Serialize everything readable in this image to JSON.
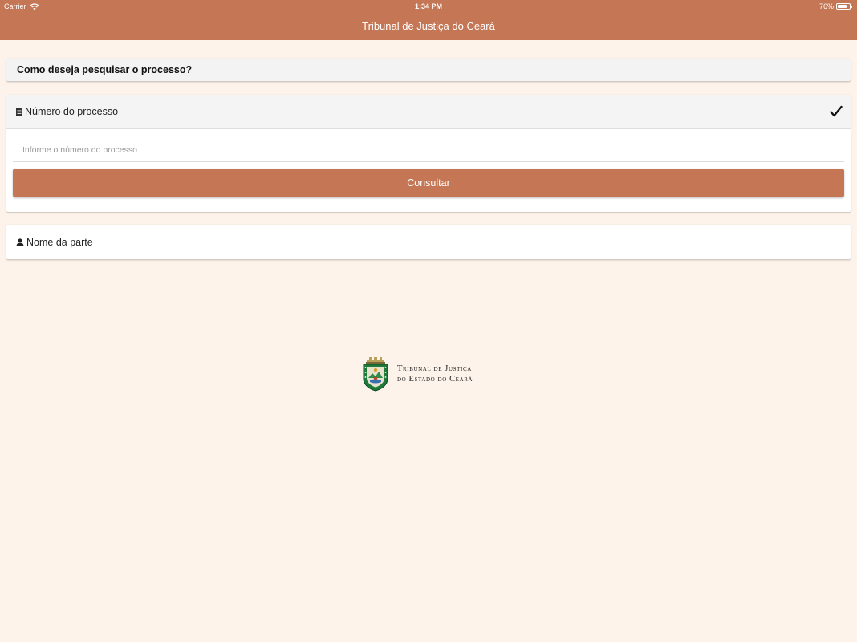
{
  "status_bar": {
    "carrier": "Carrier",
    "time": "1:34 PM",
    "battery": "76%",
    "battery_level": 0.76
  },
  "header": {
    "title": "Tribunal de Justiça do Ceará",
    "background_color": "#c57654"
  },
  "search": {
    "question": "Como deseja pesquisar o processo?",
    "numero": {
      "label": "Número do processo",
      "icon": "document-icon",
      "selected": true,
      "placeholder": "Informe o número do processo",
      "value": "",
      "button_label": "Consultar"
    },
    "nome": {
      "label": "Nome da parte",
      "icon": "user-icon"
    }
  },
  "logo": {
    "line1": "Tribunal de Justiça",
    "line2": "do Estado do Ceará"
  },
  "colors": {
    "accent": "#c57654",
    "page_background": "#fdf3ea"
  }
}
